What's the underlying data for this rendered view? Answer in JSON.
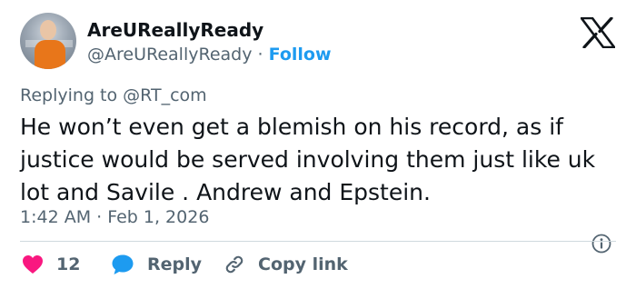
{
  "author": {
    "display_name": "AreUReallyReady",
    "handle": "@AreUReallyReady",
    "separator": "·",
    "follow_label": "Follow"
  },
  "reply_to": {
    "prefix": "Replying to",
    "mention": "@RT_com"
  },
  "tweet": {
    "text": "He won’t even get a blemish on his record, as if justice would be served involving them just like uk lot and Savile . Andrew and Epstein.",
    "timestamp": "1:42 AM · Feb 1, 2026"
  },
  "actions": {
    "like_count": "12",
    "reply_label": "Reply",
    "copy_label": "Copy link"
  },
  "icons": {
    "logo": "x-logo-icon",
    "info": "info-icon",
    "like": "heart-icon",
    "reply": "speech-bubble-icon",
    "copy": "link-icon"
  },
  "colors": {
    "accent": "#1d9bf0",
    "like": "#f91880",
    "secondary_text": "#536471"
  }
}
